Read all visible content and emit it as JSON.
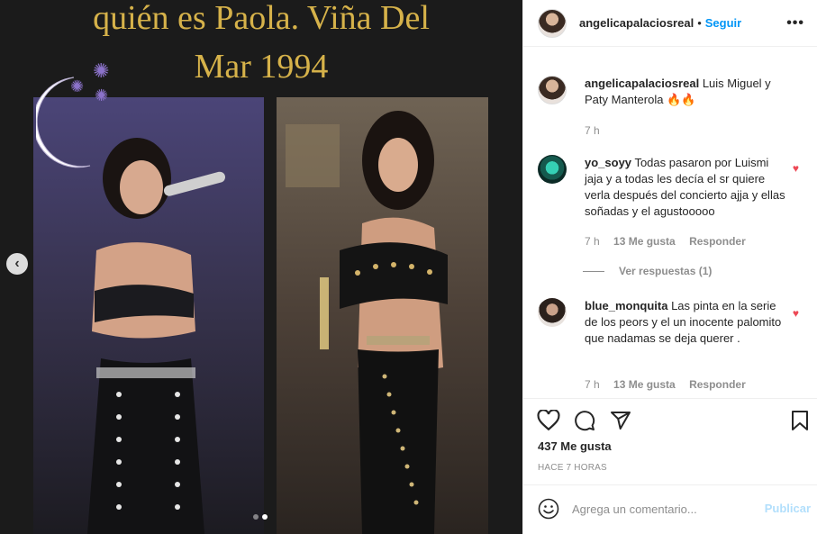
{
  "media": {
    "caption_line1": "quién es Paola. Viña Del",
    "caption_line2": "Mar 1994",
    "carousel_dots": 2,
    "active_dot": 2
  },
  "post": {
    "username": "angelicapalaciosreal",
    "follow_label": "Seguir",
    "separator": "•",
    "caption_text": "Luis Miguel y Paty Manterola 🔥🔥",
    "caption_time": "7 h"
  },
  "comments": [
    {
      "username": "yo_soyy",
      "text": "Todas pasaron por Luismi jaja y a todas les decía el sr quiere verla después del concierto ajja y ellas soñadas y el agustooooo",
      "time": "7 h",
      "likes": "13 Me gusta",
      "reply": "Responder",
      "view_replies": "Ver respuestas (1)"
    },
    {
      "username": "blue_monquita",
      "text": "Las pinta en la serie de los peors y el un inocente palomito que nadamas se deja querer .",
      "time": "7 h",
      "likes": "13 Me gusta",
      "reply": "Responder"
    }
  ],
  "footer": {
    "likes_count": "437 Me gusta",
    "time_ago": "HACE 7 HORAS",
    "comment_placeholder": "Agrega un comentario...",
    "publish_label": "Publicar"
  },
  "colors": {
    "link_blue": "#0095f6",
    "heart_red": "#ed4956",
    "caption_gold": "#d6b24a"
  }
}
